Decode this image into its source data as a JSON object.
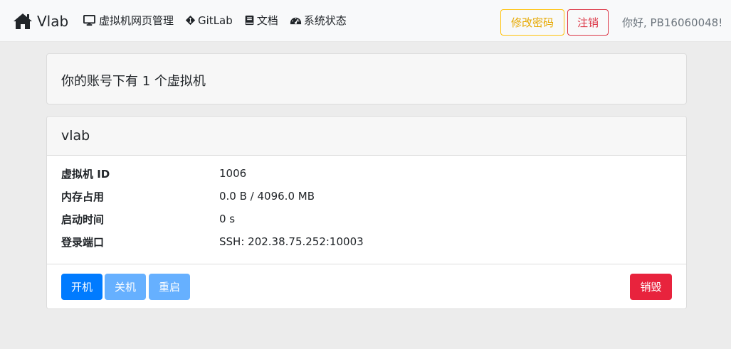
{
  "navbar": {
    "brand": "Vlab",
    "brand_icon": "home-icon",
    "links": [
      {
        "label": "虚拟机网页管理",
        "icon": "desktop-icon"
      },
      {
        "label": "GitLab",
        "icon": "git-icon"
      },
      {
        "label": "文档",
        "icon": "book-icon"
      },
      {
        "label": "系统状态",
        "icon": "tachometer-icon"
      }
    ],
    "change_password": "修改密码",
    "logout": "注销",
    "greeting": "你好, PB16060048!"
  },
  "summary": {
    "prefix": "你的账号下有 ",
    "count": "1",
    "suffix": " 个虚拟机"
  },
  "vm": {
    "name": "vlab",
    "fields": [
      {
        "label": "虚拟机 ID",
        "value": "1006"
      },
      {
        "label": "内存占用",
        "value": "0.0 B / 4096.0 MB"
      },
      {
        "label": "启动时间",
        "value": "0 s"
      },
      {
        "label": "登录端口",
        "value": "SSH: 202.38.75.252:10003"
      }
    ],
    "actions": {
      "start": "开机",
      "stop": "关机",
      "restart": "重启",
      "destroy": "销毁"
    }
  },
  "colors": {
    "primary": "#007bff",
    "primary_disabled": "#66b0ff",
    "danger": "#e8233d",
    "warning": "#ffc107",
    "navbar_bg": "#f8f9fa",
    "page_bg": "#ececec"
  }
}
